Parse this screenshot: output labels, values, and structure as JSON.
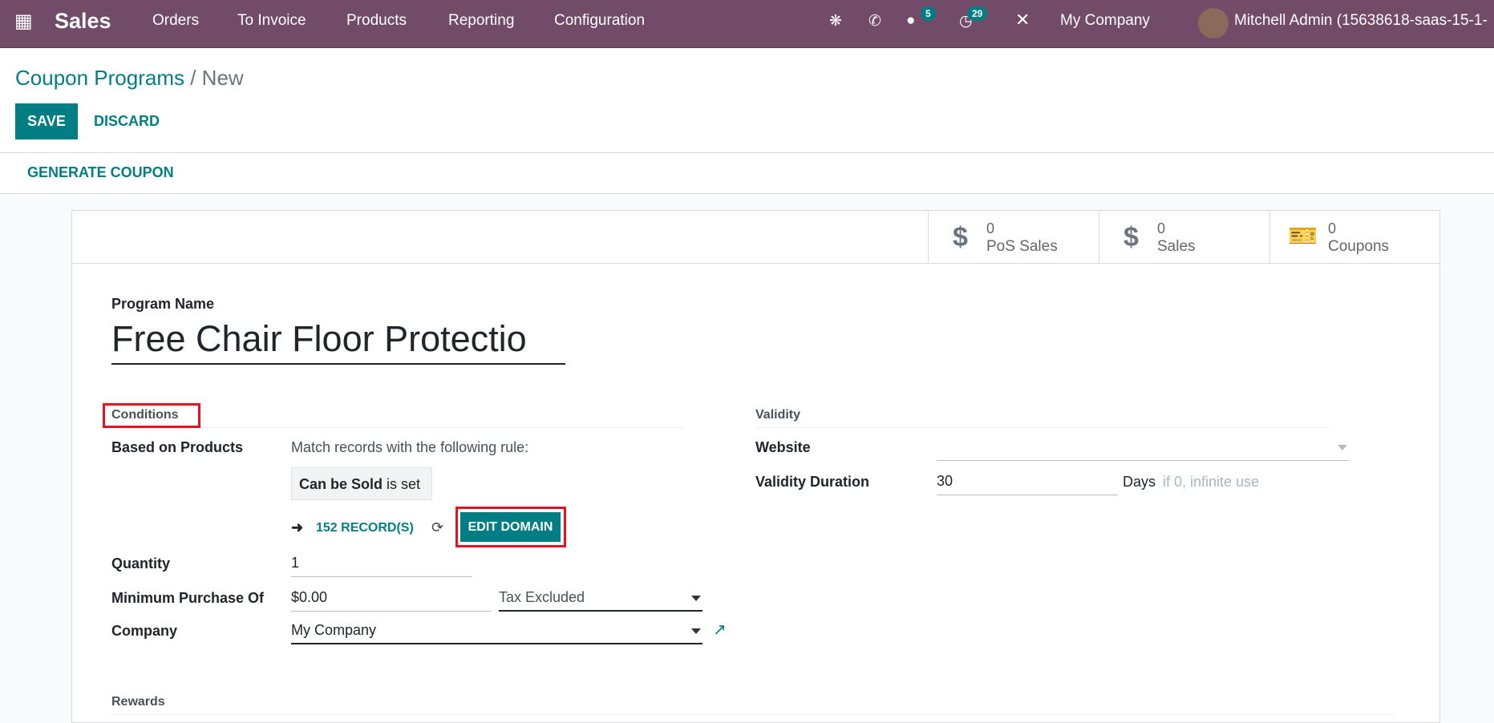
{
  "navbar": {
    "app": "Sales",
    "menu": [
      "Orders",
      "To Invoice",
      "Products",
      "Reporting",
      "Configuration"
    ],
    "messages_count": "5",
    "activities_count": "29",
    "company": "My Company",
    "user": "Mitchell Admin (15638618-saas-15-1-"
  },
  "breadcrumb": {
    "parent": "Coupon Programs",
    "separator": " / ",
    "current": "New"
  },
  "buttons": {
    "save": "SAVE",
    "discard": "DISCARD",
    "generate": "GENERATE COUPON"
  },
  "stats": [
    {
      "count": "0",
      "label": "PoS Sales",
      "icon": "dollar-icon"
    },
    {
      "count": "0",
      "label": "Sales",
      "icon": "dollar-icon"
    },
    {
      "count": "0",
      "label": "Coupons",
      "icon": "ticket-icon"
    }
  ],
  "form": {
    "program_name_label": "Program Name",
    "program_name": "Free Chair Floor Protectio",
    "conditions": {
      "title": "Conditions",
      "based_on_label": "Based on Products",
      "rule_text": "Match records with the following rule:",
      "rule_field": "Can be Sold",
      "rule_op": "is set",
      "records": "152 RECORD(S)",
      "edit_domain": "EDIT DOMAIN",
      "quantity_label": "Quantity",
      "quantity": "1",
      "min_purchase_label": "Minimum Purchase Of",
      "min_purchase": "$0.00",
      "tax_mode": "Tax Excluded",
      "company_label": "Company",
      "company": "My Company"
    },
    "validity": {
      "title": "Validity",
      "website_label": "Website",
      "website": "",
      "duration_label": "Validity Duration",
      "duration": "30",
      "unit": "Days",
      "hint": "if 0, infinite use"
    },
    "rewards_title": "Rewards"
  },
  "colors": {
    "navbar": "#714b67",
    "accent": "#017e84",
    "highlight": "#e3131f"
  }
}
